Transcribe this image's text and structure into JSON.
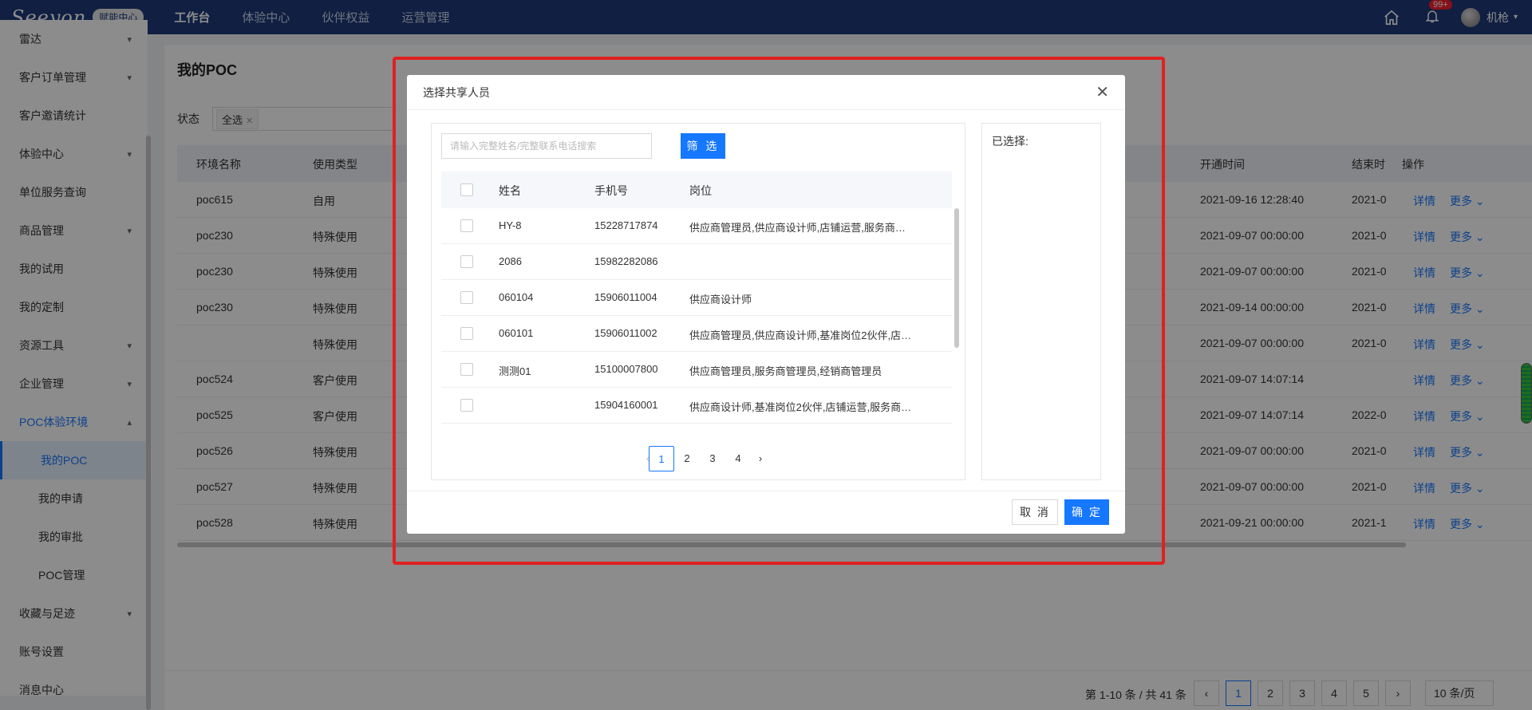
{
  "topbar": {
    "logo": "Seeyon",
    "logo_tag": "赋能中心",
    "nav": [
      "工作台",
      "体验中心",
      "伙伴权益",
      "运营管理"
    ],
    "notifications": "99+",
    "user": "机枪"
  },
  "sidebar": {
    "items": [
      {
        "label": "雷达",
        "chevron": "▾"
      },
      {
        "label": "客户订单管理",
        "chevron": "▾"
      },
      {
        "label": "客户邀请统计",
        "chevron": ""
      },
      {
        "label": "体验中心",
        "chevron": "▾"
      },
      {
        "label": "单位服务查询",
        "chevron": ""
      },
      {
        "label": "商品管理",
        "chevron": "▾"
      },
      {
        "label": "我的试用",
        "chevron": ""
      },
      {
        "label": "我的定制",
        "chevron": ""
      },
      {
        "label": "资源工具",
        "chevron": "▾"
      },
      {
        "label": "企业管理",
        "chevron": "▾"
      },
      {
        "label": "POC体验环境",
        "chevron": "▴"
      },
      {
        "label": "我的POC",
        "chevron": ""
      },
      {
        "label": "我的申请",
        "chevron": ""
      },
      {
        "label": "我的审批",
        "chevron": ""
      },
      {
        "label": "POC管理",
        "chevron": ""
      },
      {
        "label": "收藏与足迹",
        "chevron": "▾"
      },
      {
        "label": "账号设置",
        "chevron": ""
      },
      {
        "label": "消息中心",
        "chevron": ""
      }
    ]
  },
  "main": {
    "title": "我的POC",
    "filter_label": "状态",
    "filter_tag": "全选",
    "columns": [
      "环境名称",
      "使用类型",
      "开通时间",
      "结束时",
      "操作"
    ],
    "rows": [
      {
        "name": "poc615",
        "type": "自用",
        "open": "2021-09-16 12:28:40",
        "end": "2021-0"
      },
      {
        "name": "poc230",
        "type": "特殊使用",
        "open": "2021-09-07 00:00:00",
        "end": "2021-0"
      },
      {
        "name": "poc230",
        "type": "特殊使用",
        "open": "2021-09-07 00:00:00",
        "end": "2021-0"
      },
      {
        "name": "poc230",
        "type": "特殊使用",
        "open": "2021-09-14 00:00:00",
        "end": "2021-0"
      },
      {
        "name": "",
        "type": "特殊使用",
        "open": "2021-09-07 00:00:00",
        "end": "2021-0"
      },
      {
        "name": "poc524",
        "type": "客户使用",
        "open": "2021-09-07 14:07:14",
        "end": ""
      },
      {
        "name": "poc525",
        "type": "客户使用",
        "open": "2021-09-07 14:07:14",
        "end": "2022-0"
      },
      {
        "name": "poc526",
        "type": "特殊使用",
        "open": "2021-09-07 00:00:00",
        "end": "2021-0"
      },
      {
        "name": "poc527",
        "type": "特殊使用",
        "open": "2021-09-07 00:00:00",
        "end": "2021-0"
      },
      {
        "name": "poc528",
        "type": "特殊使用",
        "open": "2021-09-21 00:00:00",
        "end": "2021-1"
      }
    ],
    "op_detail": "详情",
    "op_more": "更多",
    "pager_info": "第 1-10 条 / 共 41 条",
    "pages": [
      "1",
      "2",
      "3",
      "4",
      "5"
    ],
    "page_size": "10 条/页"
  },
  "modal": {
    "title": "选择共享人员",
    "search_placeholder": "请输入完整姓名/完整联系电话搜索",
    "filter_button": "筛 选",
    "columns": [
      "姓名",
      "手机号",
      "岗位"
    ],
    "rows": [
      {
        "name": "HY-8",
        "phone": "15228717874",
        "post": "供应商管理员,供应商设计师,店铺运营,服务商…"
      },
      {
        "name": "2086",
        "phone": "15982282086",
        "post": ""
      },
      {
        "name": "060104",
        "phone": "15906011004",
        "post": "供应商设计师"
      },
      {
        "name": "060101",
        "phone": "15906011002",
        "post": "供应商管理员,供应商设计师,基准岗位2伙伴,店…"
      },
      {
        "name": "测测01",
        "phone": "15100007800",
        "post": "供应商管理员,服务商管理员,经销商管理员"
      },
      {
        "name": "",
        "phone": "15904160001",
        "post": "供应商设计师,基准岗位2伙伴,店铺运营,服务商…"
      }
    ],
    "pages": [
      "1",
      "2",
      "3",
      "4"
    ],
    "selected_label": "已选择:",
    "cancel": "取 消",
    "confirm": "确 定"
  }
}
